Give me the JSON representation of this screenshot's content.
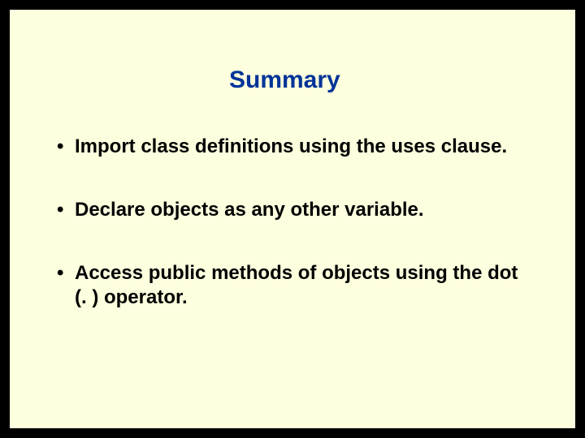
{
  "slide": {
    "title": "Summary",
    "bullets": [
      "Import class definitions using the uses clause.",
      "Declare objects as any other variable.",
      "Access public methods of objects using the dot (. ) operator."
    ]
  }
}
